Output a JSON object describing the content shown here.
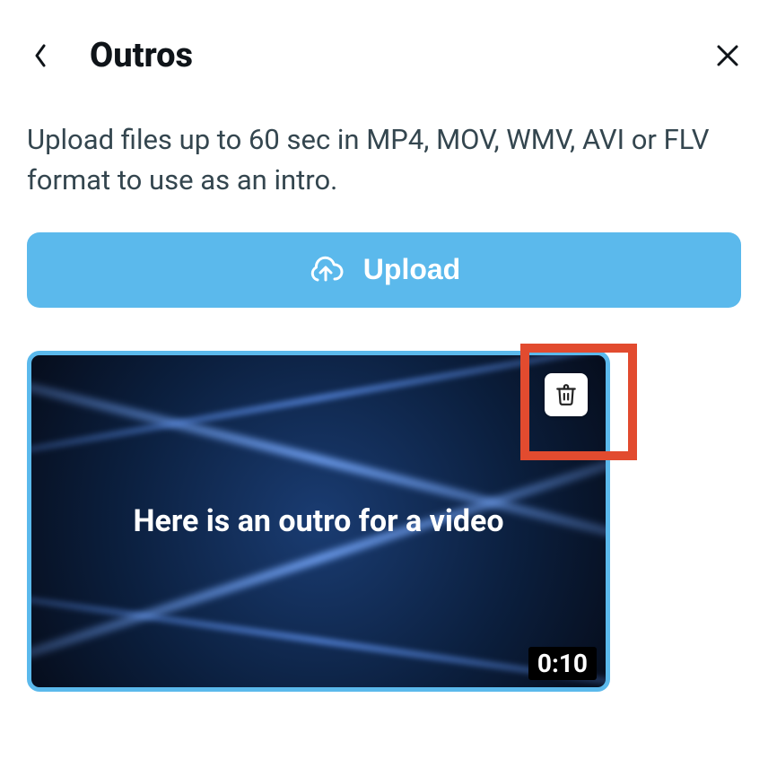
{
  "header": {
    "title": "Outros"
  },
  "description": "Upload files up to 60 sec in MP4, MOV, WMV, AVI or FLV format to use as an intro.",
  "upload": {
    "label": "Upload"
  },
  "thumbnail": {
    "caption": "Here is an outro for a video",
    "duration": "0:10"
  }
}
